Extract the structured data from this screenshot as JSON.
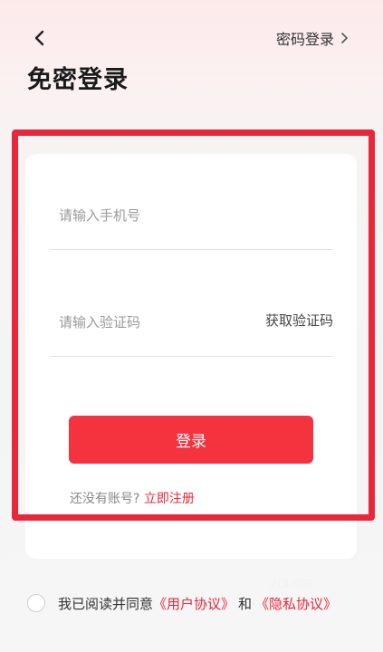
{
  "header": {
    "title": "免密登录",
    "password_login_label": "密码登录",
    "back_icon": "chevron-left-icon",
    "forward_icon": "chevron-right-icon"
  },
  "form": {
    "phone_placeholder": "请输入手机号",
    "phone_value": "",
    "code_placeholder": "请输入验证码",
    "code_value": "",
    "get_code_label": "获取验证码",
    "login_button_label": "登录",
    "register_prompt": "还没有账号?",
    "register_link": "立即注册"
  },
  "agreement": {
    "checked": false,
    "prefix": "我已阅读并同意",
    "user_agreement": "《用户协议》",
    "and": "和",
    "privacy_policy": "《隐私协议》"
  },
  "watermark": "ZOL问答",
  "colors": {
    "accent": "#f4333f",
    "highlight_border": "#e8283a",
    "background_top": "#fde9ea"
  }
}
